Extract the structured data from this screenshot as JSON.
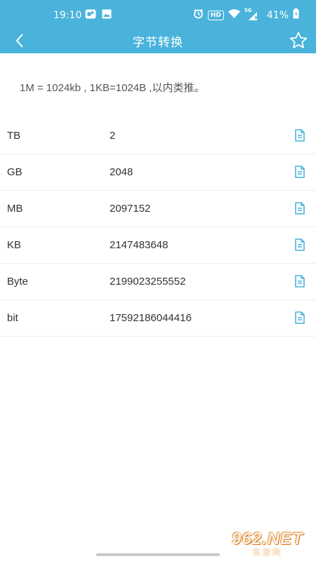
{
  "status_bar": {
    "time": "19:10",
    "network_label": "HD",
    "signal_label": "5G",
    "battery": "41%"
  },
  "app_bar": {
    "title": "字节转换"
  },
  "hint": "1M = 1024kb , 1KB=1024B ,以内类推。",
  "rows": [
    {
      "unit": "TB",
      "value": "2"
    },
    {
      "unit": "GB",
      "value": "2048"
    },
    {
      "unit": "MB",
      "value": "2097152"
    },
    {
      "unit": "KB",
      "value": "2147483648"
    },
    {
      "unit": "Byte",
      "value": "2199023255552"
    },
    {
      "unit": "bit",
      "value": "17592186044416"
    }
  ],
  "watermark": {
    "logo": "962.NET",
    "sub": "乐游网"
  },
  "colors": {
    "header": "#4ab3dc",
    "accent": "#4ab3dc",
    "text": "#333333"
  },
  "icons": {
    "back": "chevron-left-icon",
    "favorite": "star-icon",
    "copy": "document-icon"
  }
}
